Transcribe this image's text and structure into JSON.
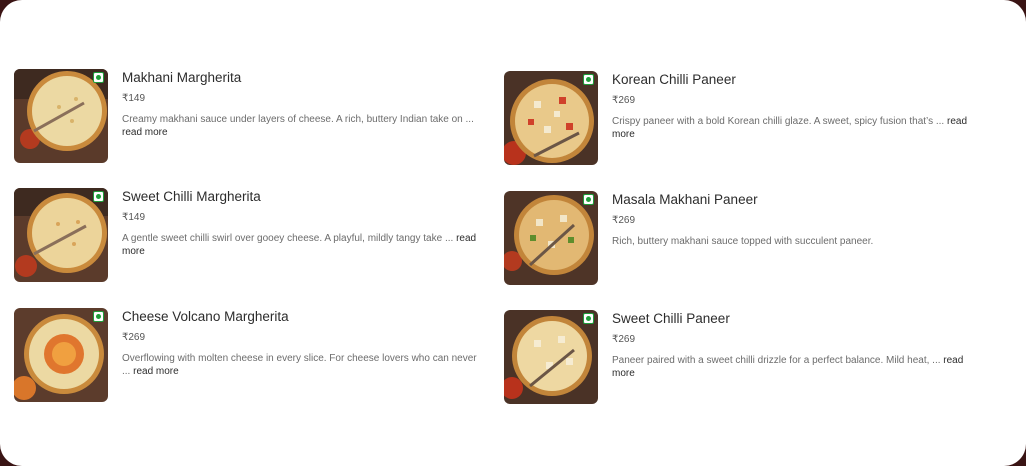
{
  "menu": {
    "items": [
      {
        "name": "Makhani Margherita",
        "price": "₹149",
        "desc": "Creamy makhani sauce under layers of cheese. A rich, buttery Indian take on ...",
        "more": "read more",
        "veg_icon": "veg-indicator-icon",
        "image": "pizza-makhani-margherita"
      },
      {
        "name": "Korean Chilli Paneer",
        "price": "₹269",
        "desc": "Crispy paneer with a bold Korean chilli glaze. A sweet, spicy fusion that’s ...",
        "more": "read more",
        "veg_icon": "veg-indicator-icon",
        "image": "pizza-korean-chilli-paneer"
      },
      {
        "name": "Sweet Chilli Margherita",
        "price": "₹149",
        "desc": "A gentle sweet chilli swirl over gooey cheese. A playful, mildly tangy take ...",
        "more": "read more",
        "veg_icon": "veg-indicator-icon",
        "image": "pizza-sweet-chilli-margherita"
      },
      {
        "name": "Masala Makhani Paneer",
        "price": "₹269",
        "desc": "Rich, buttery makhani sauce topped with succulent paneer.",
        "more": "",
        "veg_icon": "veg-indicator-icon",
        "image": "pizza-masala-makhani-paneer"
      },
      {
        "name": "Cheese Volcano Margherita",
        "price": "₹269",
        "desc": "Overflowing with molten cheese in every slice. For cheese lovers who can never ...",
        "more": "read more",
        "veg_icon": "veg-indicator-icon",
        "image": "pizza-cheese-volcano-margherita"
      },
      {
        "name": "Sweet Chilli Paneer",
        "price": "₹269",
        "desc": "Paneer paired with a sweet chilli drizzle for a perfect balance. Mild heat, ...",
        "more": "read more",
        "veg_icon": "veg-indicator-icon",
        "image": "pizza-sweet-chilli-paneer"
      }
    ]
  },
  "colors": {
    "veg_green": "#1f9d3a",
    "page_bg": "#ffffff",
    "frame": "#3a1414"
  }
}
